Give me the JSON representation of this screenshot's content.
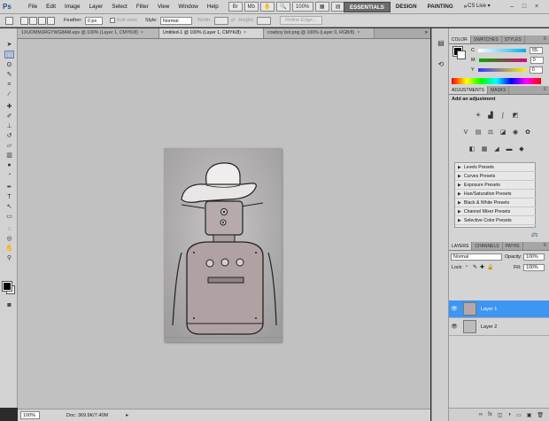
{
  "menubar": {
    "logo": "Ps",
    "menus": [
      "File",
      "Edit",
      "Image",
      "Layer",
      "Select",
      "Filter",
      "View",
      "Window",
      "Help"
    ],
    "zoom": "100%",
    "workspaces": [
      "ESSENTIALS",
      "DESIGN",
      "PAINTING"
    ],
    "more": "»",
    "cslive": "CS Live ▾",
    "window_controls": [
      "–",
      "□",
      "×"
    ]
  },
  "options": {
    "feather_label": "Feather:",
    "feather_value": "0 px",
    "antialias_label": "Anti-alias",
    "style_label": "Style:",
    "style_value": "Normal",
    "width_label": "Width:",
    "height_label": "Height:",
    "refine_label": "Refine Edge..."
  },
  "tabs": [
    {
      "label": "1XUOMMJRGYWG8AM.eps @ 100% (Layer 1, CMYK/8)",
      "active": false
    },
    {
      "label": "Untitled-1 @ 100% (Layer 1, CMYK/8)",
      "active": true
    },
    {
      "label": "cowboy bot.png @ 100% (Layer 0, RGB/8)",
      "active": false
    }
  ],
  "status": {
    "zoom": "100%",
    "doc": "Doc: 369.9K/7.40M"
  },
  "color_panel": {
    "tabs": [
      "COLOR",
      "SWATCHES",
      "STYLES"
    ],
    "channels": [
      {
        "label": "C",
        "value": "55"
      },
      {
        "label": "M",
        "value": "0"
      },
      {
        "label": "Y",
        "value": "0"
      }
    ]
  },
  "adjustments_panel": {
    "tabs": [
      "ADJUSTMENTS",
      "MASKS"
    ],
    "heading": "Add an adjustment",
    "presets": [
      "Levels Presets",
      "Curves Presets",
      "Exposure Presets",
      "Hue/Saturation Presets",
      "Black & White Presets",
      "Channel Mixer Presets",
      "Selective Color Presets"
    ]
  },
  "layers_panel": {
    "tabs": [
      "LAYERS",
      "CHANNELS",
      "PATHS"
    ],
    "blend_mode": "Normal",
    "opacity_label": "Opacity:",
    "opacity_value": "100%",
    "lock_label": "Lock:",
    "fill_label": "Fill:",
    "fill_value": "100%",
    "layers": [
      {
        "name": "Layer 1",
        "active": true
      },
      {
        "name": "Layer 2",
        "active": false
      }
    ]
  }
}
